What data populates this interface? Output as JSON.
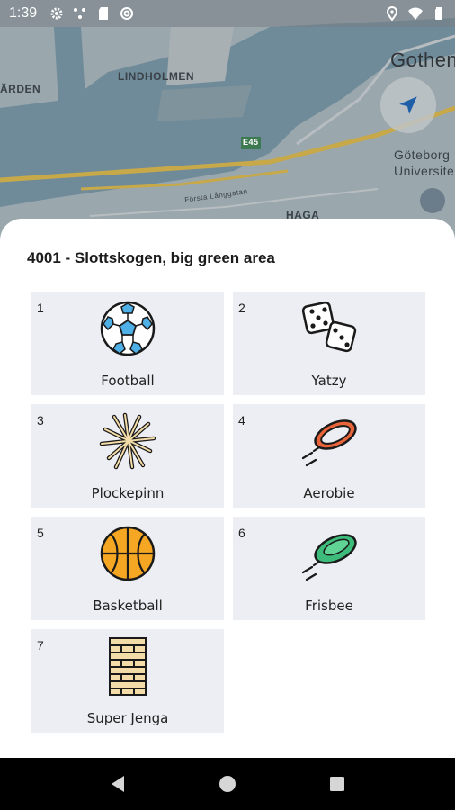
{
  "status_bar": {
    "time": "1:39",
    "left_icons": [
      "gear-icon",
      "network-icon",
      "sd-card-icon",
      "at-icon"
    ],
    "right_icons": [
      "location-icon",
      "wifi-icon",
      "battery-icon"
    ]
  },
  "map": {
    "labels": {
      "lindholmen": "LINDHOLMEN",
      "arden": "ÄRDEN",
      "gothenburg": "Gothen",
      "goteborg": "Göteborg",
      "universitet": "Universite",
      "haga": "HAGA",
      "e45": "E45",
      "street": "Första Långgatan"
    }
  },
  "sheet": {
    "title": "4001 - Slottskogen, big green area",
    "items": [
      {
        "number": "1",
        "label": "Football",
        "icon": "football-icon"
      },
      {
        "number": "2",
        "label": "Yatzy",
        "icon": "dice-icon"
      },
      {
        "number": "3",
        "label": "Plockepinn",
        "icon": "sticks-icon"
      },
      {
        "number": "4",
        "label": "Aerobie",
        "icon": "aerobie-ring-icon"
      },
      {
        "number": "5",
        "label": "Basketball",
        "icon": "basketball-icon"
      },
      {
        "number": "6",
        "label": "Frisbee",
        "icon": "frisbee-icon"
      },
      {
        "number": "7",
        "label": "Super Jenga",
        "icon": "jenga-tower-icon"
      }
    ]
  },
  "colors": {
    "card_bg": "#edeef4",
    "football_blue": "#4fb0e8",
    "basketball_orange": "#f5a623",
    "frisbee_green": "#3dbb7a",
    "aerobie_red": "#e8643a",
    "jenga_wood": "#f3dca8"
  }
}
